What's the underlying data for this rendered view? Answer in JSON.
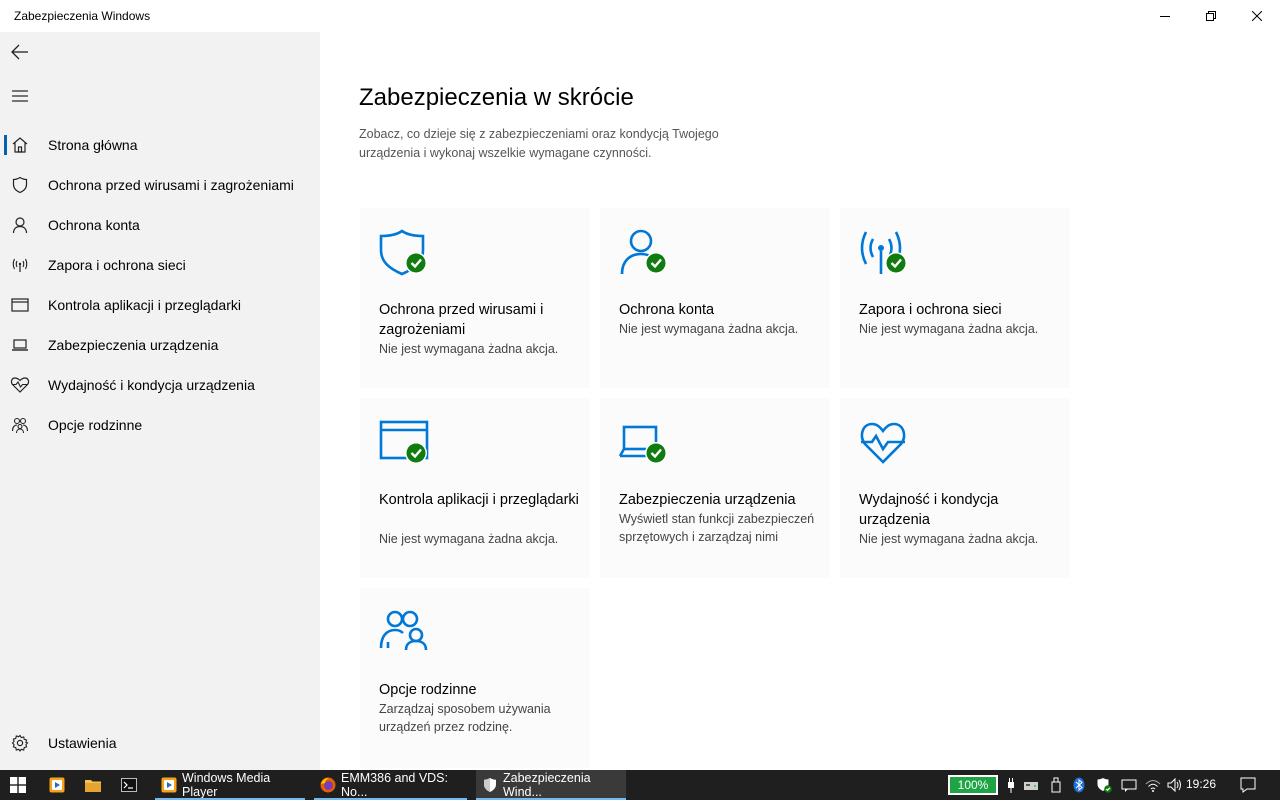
{
  "window": {
    "title": "Zabezpieczenia Windows"
  },
  "sidebar": {
    "items": [
      {
        "label": "Strona główna",
        "icon": "home-icon",
        "active": true
      },
      {
        "label": "Ochrona przed wirusami i zagrożeniami",
        "icon": "shield-icon"
      },
      {
        "label": "Ochrona konta",
        "icon": "person-icon"
      },
      {
        "label": "Zapora i ochrona sieci",
        "icon": "antenna-icon"
      },
      {
        "label": "Kontrola aplikacji i przeglądarki",
        "icon": "app-window-icon"
      },
      {
        "label": "Zabezpieczenia urządzenia",
        "icon": "laptop-icon"
      },
      {
        "label": "Wydajność i kondycja urządzenia",
        "icon": "heart-pulse-icon"
      },
      {
        "label": "Opcje rodzinne",
        "icon": "family-icon"
      }
    ],
    "settings_label": "Ustawienia"
  },
  "main": {
    "title": "Zabezpieczenia w skrócie",
    "subtitle": "Zobacz, co dzieje się z zabezpieczeniami oraz kondycją Twojego urządzenia i wykonaj wszelkie wymagane czynności.",
    "cards": [
      {
        "title": "Ochrona przed wirusami i zagrożeniami",
        "desc": "Nie jest wymagana żadna akcja.",
        "icon": "shield-check-icon",
        "status": "ok"
      },
      {
        "title": "Ochrona konta",
        "desc": "Nie jest wymagana żadna akcja.",
        "icon": "person-check-icon",
        "status": "ok"
      },
      {
        "title": "Zapora i ochrona sieci",
        "desc": "Nie jest wymagana żadna akcja.",
        "icon": "antenna-check-icon",
        "status": "ok"
      },
      {
        "title": "Kontrola aplikacji i przeglądarki",
        "desc": "Nie jest wymagana żadna akcja.",
        "icon": "app-window-check-icon",
        "status": "ok"
      },
      {
        "title": "Zabezpieczenia urządzenia",
        "desc": "Wyświetl stan funkcji zabezpieczeń sprzętowych i zarządzaj nimi",
        "icon": "laptop-check-icon",
        "status": "ok"
      },
      {
        "title": "Wydajność i kondycja urządzenia",
        "desc": "Nie jest wymagana żadna akcja.",
        "icon": "heart-pulse-icon",
        "status": "none"
      },
      {
        "title": "Opcje rodzinne",
        "desc": "Zarządzaj sposobem używania urządzeń przez rodzinę.",
        "icon": "family-icon",
        "status": "none"
      }
    ]
  },
  "taskbar": {
    "apps": [
      {
        "label": "Windows Media Player",
        "icon": "media-player-icon"
      },
      {
        "label": "EMM386 and VDS: No...",
        "icon": "firefox-icon"
      },
      {
        "label": "Zabezpieczenia Wind...",
        "icon": "shield-icon",
        "active": true
      }
    ],
    "battery": "100%",
    "time": "19:26"
  },
  "colors": {
    "accent": "#0063b1",
    "icon_blue": "#0078d7",
    "check_green": "#107c10",
    "sidebar_bg": "#f2f2f2",
    "taskbar_bg": "#1f1f1f"
  }
}
